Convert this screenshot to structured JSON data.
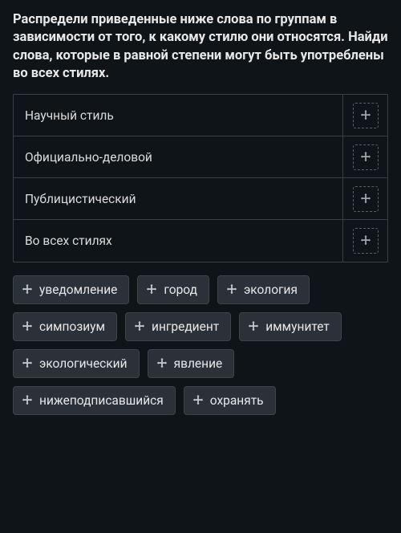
{
  "instructions": "Распредели приведенные ниже слова по группам в зависимости от того, к какому стилю они относятся. Найди слова, которые в равной степени могут быть употреблены во всех стилях.",
  "categories": [
    {
      "label": "Научный стиль"
    },
    {
      "label": "Официально-деловой"
    },
    {
      "label": "Публицистический"
    },
    {
      "label": "Во всех стилях"
    }
  ],
  "words": [
    "уведомление",
    "город",
    "экология",
    "симпозиум",
    "ингредиент",
    "иммунитет",
    "экологический",
    "явление",
    "нижеподписавшийся",
    "охранять"
  ]
}
